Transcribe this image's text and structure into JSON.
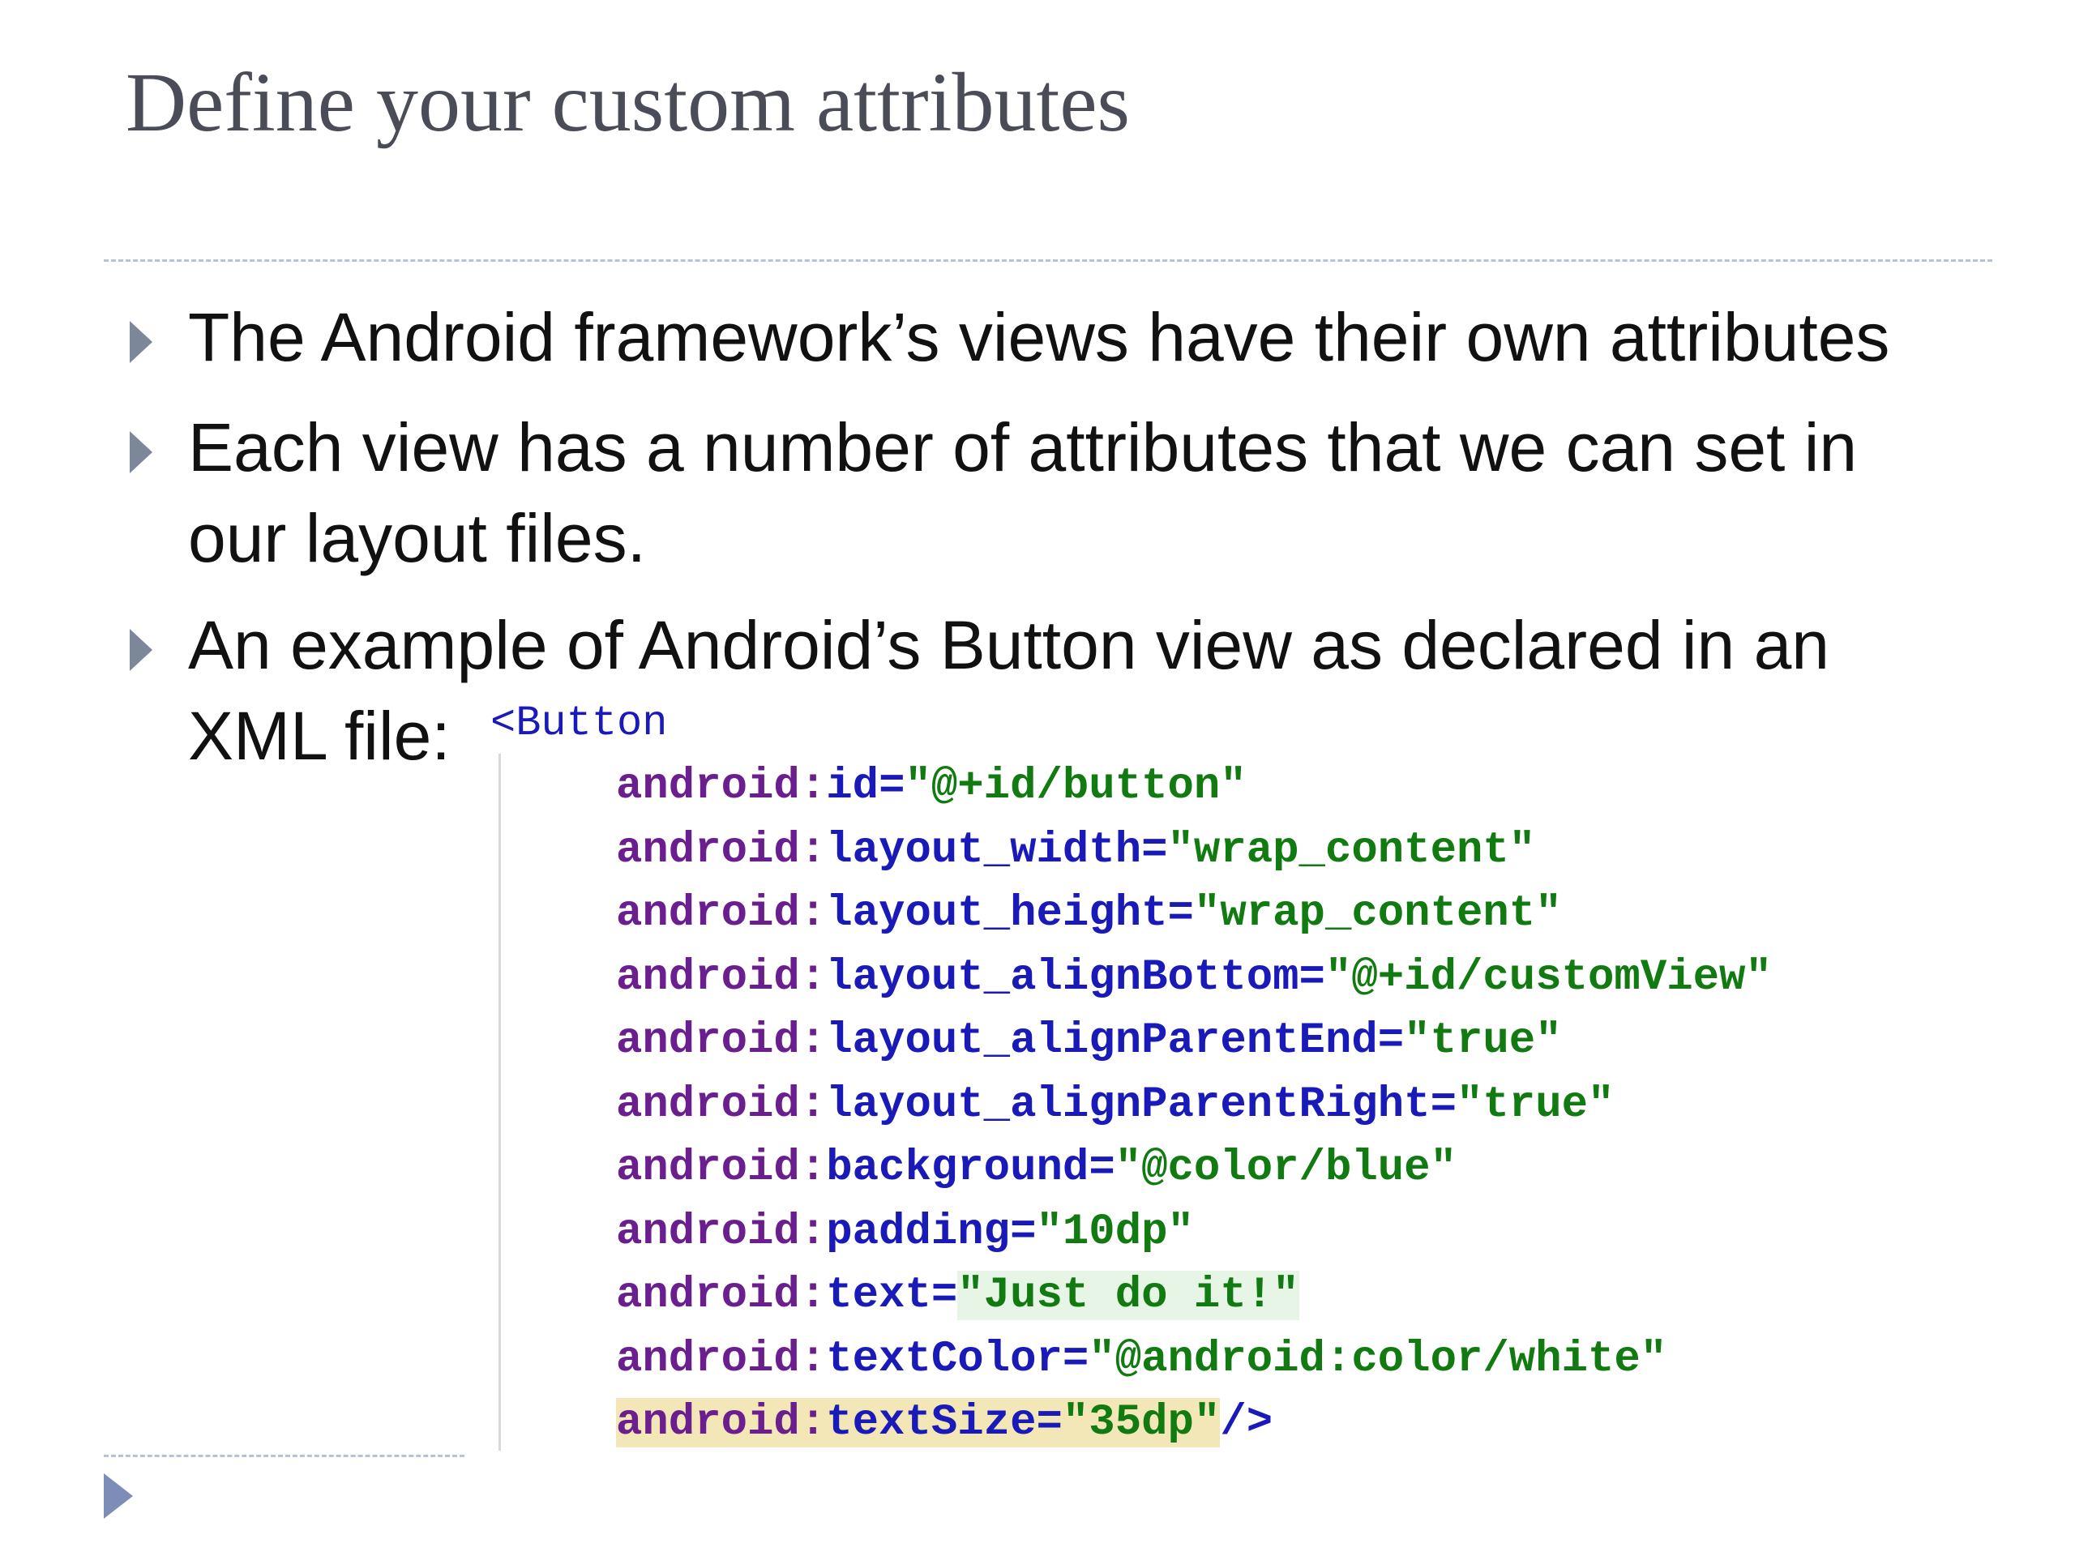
{
  "title": "Define your custom attributes",
  "bullets": [
    "The Android framework’s views have their own attributes",
    "Each view has a number of attributes that we can set in\nour layout files.",
    "An example of Android’s Button view as declared in an\nXML file:"
  ],
  "code": {
    "open_tag": "<Button",
    "attributes": [
      {
        "ns": "android:",
        "name": "id",
        "eq": "=",
        "value": "\"@+id/button\"",
        "suffix": ""
      },
      {
        "ns": "android:",
        "name": "layout_width",
        "eq": "=",
        "value": "\"wrap_content\"",
        "suffix": ""
      },
      {
        "ns": "android:",
        "name": "layout_height",
        "eq": "=",
        "value": "\"wrap_content\"",
        "suffix": ""
      },
      {
        "ns": "android:",
        "name": "layout_alignBottom",
        "eq": "=",
        "value": "\"@+id/customView\"",
        "suffix": ""
      },
      {
        "ns": "android:",
        "name": "layout_alignParentEnd",
        "eq": "=",
        "value": "\"true\"",
        "suffix": ""
      },
      {
        "ns": "android:",
        "name": "layout_alignParentRight",
        "eq": "=",
        "value": "\"true\"",
        "suffix": ""
      },
      {
        "ns": "android:",
        "name": "background",
        "eq": "=",
        "value": "\"@color/blue\"",
        "suffix": ""
      },
      {
        "ns": "android:",
        "name": "padding",
        "eq": "=",
        "value": "\"10dp\"",
        "suffix": ""
      },
      {
        "ns": "android:",
        "name": "text",
        "eq": "=",
        "value": "\"Just do it!\"",
        "suffix": ""
      },
      {
        "ns": "android:",
        "name": "textColor",
        "eq": "=",
        "value": "\"@android:color/white\"",
        "suffix": ""
      },
      {
        "ns": "android:",
        "name": "textSize",
        "eq": "=",
        "value": "\"35dp\"",
        "suffix": "/>"
      }
    ]
  },
  "colors": {
    "title": "#4a4d57",
    "bullet_marker": "#7d879a",
    "code_namespace": "#6b1f8f",
    "code_attribute": "#1a1ab8",
    "code_value": "#117a11",
    "highlight_text_value": "#e6f5e6",
    "highlight_last_line": "#f3e7b7"
  },
  "icons": {
    "bullet": "right-triangle-icon",
    "footer": "right-triangle-icon"
  }
}
